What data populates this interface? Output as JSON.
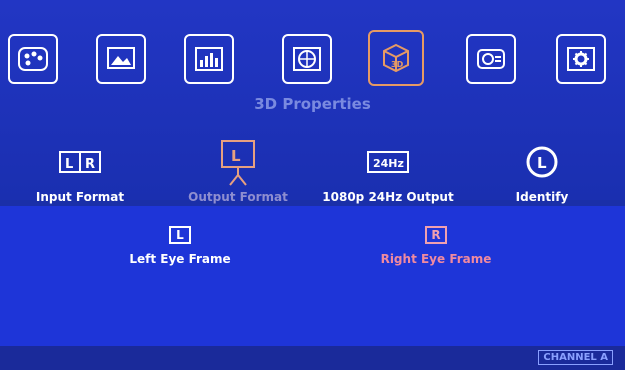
{
  "header": {
    "title": "3D Properties",
    "tabs": [
      {
        "name": "color-palette"
      },
      {
        "name": "picture"
      },
      {
        "name": "levels"
      },
      {
        "name": "globe"
      },
      {
        "name": "3d",
        "active": true
      },
      {
        "name": "projector"
      },
      {
        "name": "settings"
      }
    ]
  },
  "options": [
    {
      "label": "Input Format",
      "icon": "lr-icon"
    },
    {
      "label": "Output Format",
      "icon": "output-format-icon",
      "dim": true
    },
    {
      "label": "1080p 24Hz Output",
      "icon": "24hz-icon",
      "icon_text": "24Hz"
    },
    {
      "label": "Identify",
      "icon": "identify-icon",
      "icon_text": "L"
    }
  ],
  "eye_frames": [
    {
      "label": "Left Eye Frame",
      "icon_text": "L"
    },
    {
      "label": "Right Eye Frame",
      "icon_text": "R",
      "selected": true
    }
  ],
  "footer": {
    "channel": "CHANNEL A"
  },
  "colors": {
    "background": "#1a2fa8",
    "active_tab_border": "#e69a64",
    "highlight_text": "#f08aa0"
  }
}
